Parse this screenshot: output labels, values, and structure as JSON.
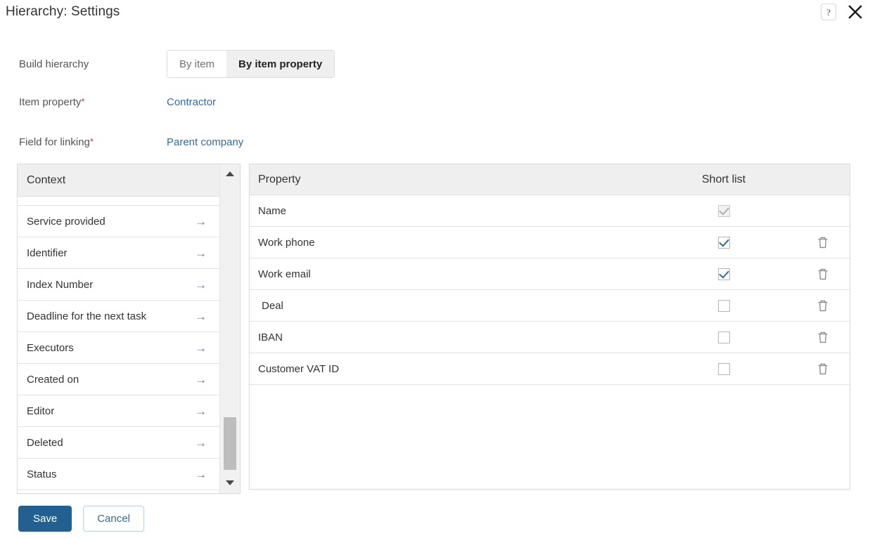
{
  "header": {
    "title": "Hierarchy: Settings",
    "help_label": "?",
    "close_label": "✕"
  },
  "form": {
    "build_hierarchy": {
      "label": "Build hierarchy",
      "options": [
        "By item",
        "By item property"
      ],
      "selected": "By item property"
    },
    "item_property": {
      "label": "Item property",
      "required_marker": "*",
      "value": "Contractor"
    },
    "field_for_linking": {
      "label": "Field for linking",
      "required_marker": "*",
      "value": "Parent company"
    }
  },
  "context_panel": {
    "header": "Context",
    "arrow_glyph": "→",
    "items": [
      "Service provided",
      "Identifier",
      "Index Number",
      "Deadline for the next task",
      "Executors",
      "Created on",
      "Editor",
      "Deleted",
      "Status"
    ]
  },
  "property_table": {
    "columns": {
      "property": "Property",
      "short_list": "Short list"
    },
    "rows": [
      {
        "name": "Name",
        "short_list": true,
        "checkbox_disabled": true,
        "deletable": false,
        "indented": false
      },
      {
        "name": "Work phone",
        "short_list": true,
        "checkbox_disabled": false,
        "deletable": true,
        "indented": false
      },
      {
        "name": "Work email",
        "short_list": true,
        "checkbox_disabled": false,
        "deletable": true,
        "indented": false
      },
      {
        "name": "Deal",
        "short_list": false,
        "checkbox_disabled": false,
        "deletable": true,
        "indented": true
      },
      {
        "name": "IBAN",
        "short_list": false,
        "checkbox_disabled": false,
        "deletable": true,
        "indented": false
      },
      {
        "name": "Customer VAT ID",
        "short_list": false,
        "checkbox_disabled": false,
        "deletable": true,
        "indented": false
      }
    ]
  },
  "footer": {
    "save_label": "Save",
    "cancel_label": "Cancel"
  },
  "colors": {
    "link": "#2f6ca3",
    "primary_button": "#226092",
    "required": "#e03030",
    "arrow": "#6b6bb0",
    "header_bg": "#efefef"
  }
}
